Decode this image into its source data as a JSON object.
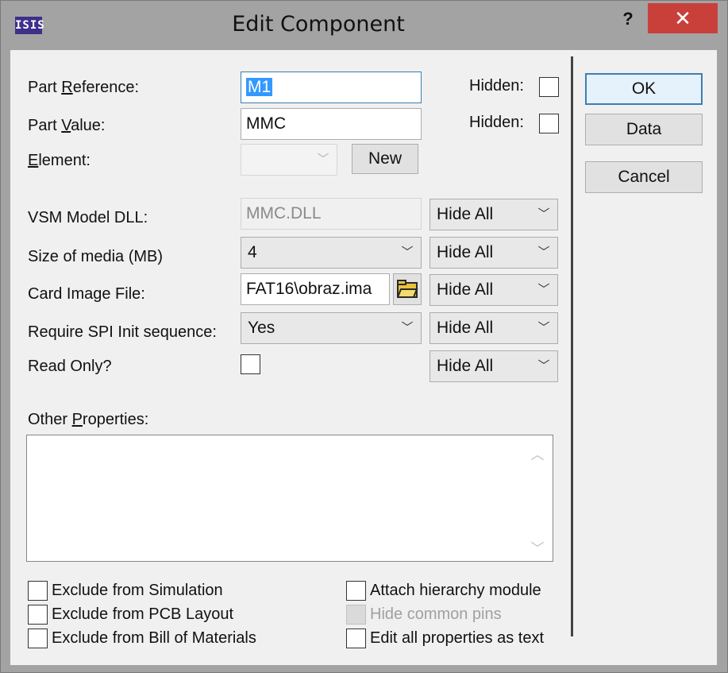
{
  "window": {
    "app_icon": "ISIS",
    "title": "Edit Component",
    "help_label": "?",
    "close_label": "✕"
  },
  "part_reference": {
    "label_pre": "Part ",
    "label_ul": "R",
    "label_post": "eference:",
    "value": "M1",
    "hidden_label": "Hidden:"
  },
  "part_value": {
    "label_pre": "Part ",
    "label_ul": "V",
    "label_post": "alue:",
    "value": "MMC",
    "hidden_label": "Hidden:"
  },
  "element": {
    "label_ul": "E",
    "label_post": "lement:",
    "value": "",
    "new_label": "New"
  },
  "properties": [
    {
      "label": "VSM Model DLL:",
      "value": "MMC.DLL",
      "visibility": "Hide All"
    },
    {
      "label": "Size of media (MB)",
      "value": "4",
      "visibility": "Hide All"
    },
    {
      "label": "Card Image File:",
      "value": "FAT16\\obraz.ima",
      "visibility": "Hide All"
    },
    {
      "label": "Require SPI Init sequence:",
      "value": "Yes",
      "visibility": "Hide All"
    },
    {
      "label": "Read Only?",
      "visibility": "Hide All"
    }
  ],
  "other_properties": {
    "label_pre": "Other ",
    "label_ul": "P",
    "label_post": "roperties:",
    "value": ""
  },
  "buttons": {
    "ok": "OK",
    "data": "Data",
    "cancel": "Cancel"
  },
  "checkboxes_left": [
    {
      "label": "Exclude from Simulation",
      "checked": false
    },
    {
      "label": "Exclude from PCB Layout",
      "checked": false
    },
    {
      "label": "Exclude from Bill of Materials",
      "checked": false
    }
  ],
  "checkboxes_right": [
    {
      "label": "Attach hierarchy module",
      "checked": false
    },
    {
      "label": "Hide common pins",
      "checked": false,
      "disabled": true
    },
    {
      "label": "Edit all properties as text",
      "checked": false
    }
  ]
}
